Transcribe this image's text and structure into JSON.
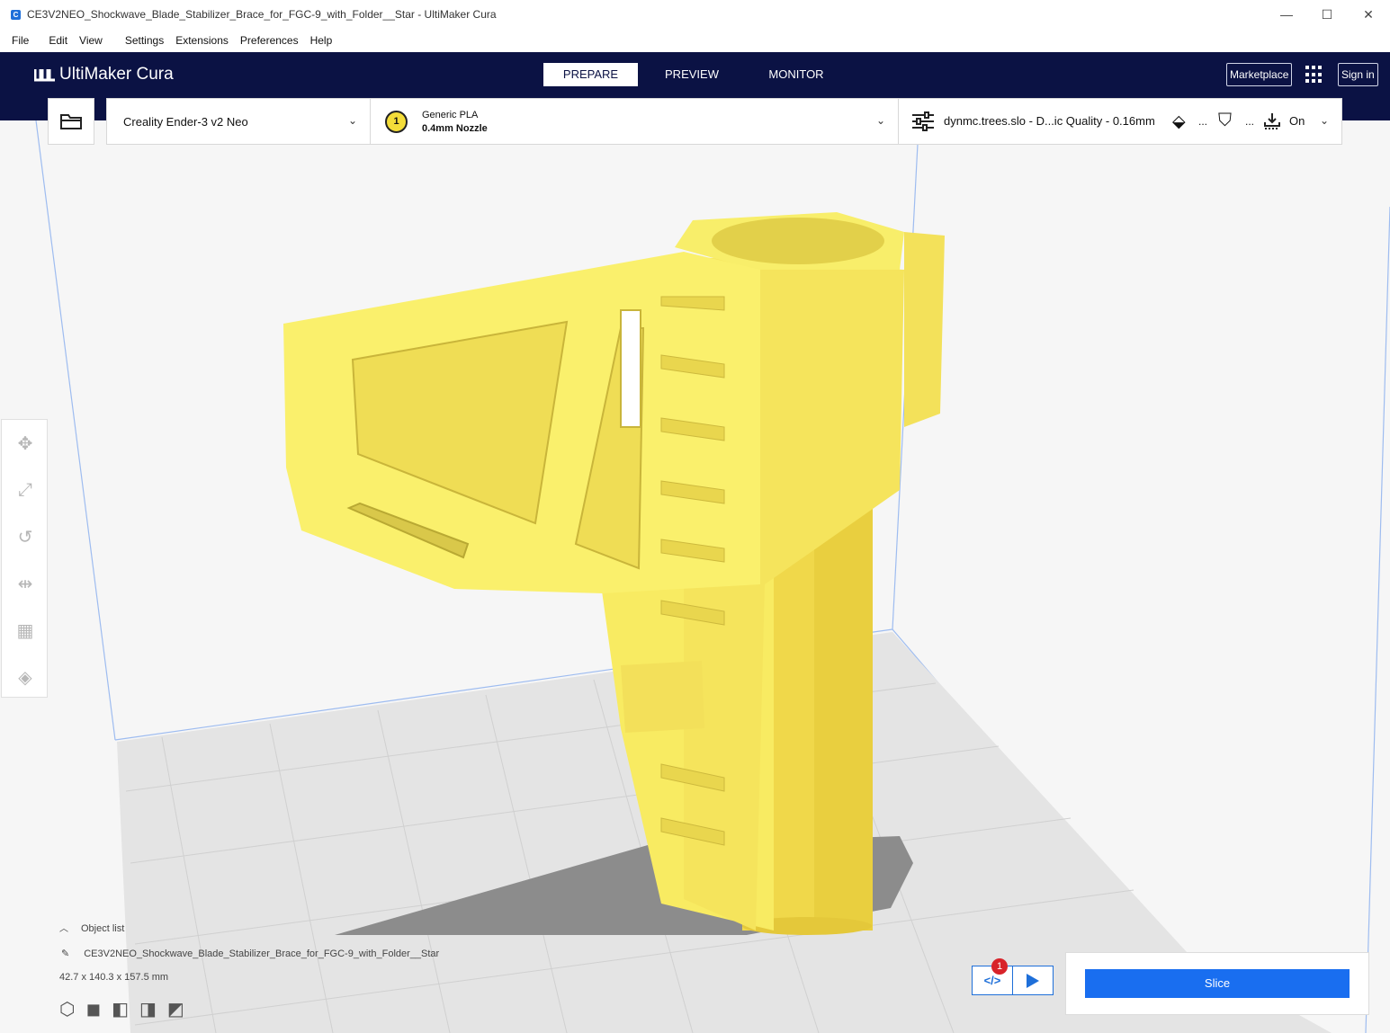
{
  "window": {
    "title": "CE3V2NEO_Shockwave_Blade_Stabilizer_Brace_for_FGC-9_with_Folder__Star - UltiMaker Cura",
    "app_icon_letter": "C",
    "minimize": "—",
    "maximize": "☐",
    "close": "✕"
  },
  "menu": {
    "items": [
      "File",
      "Edit",
      "View",
      "Settings",
      "Extensions",
      "Preferences",
      "Help"
    ]
  },
  "header": {
    "logo_mark": "\\/\\/",
    "logo_text": "UltiMaker Cura",
    "stages": [
      {
        "label": "PREPARE",
        "active": true
      },
      {
        "label": "PREVIEW",
        "active": false
      },
      {
        "label": "MONITOR",
        "active": false
      }
    ],
    "marketplace": "Marketplace",
    "sign_in": "Sign in"
  },
  "toolbar": {
    "printer": "Creality Ender-3 v2 Neo",
    "extruder_number": "1",
    "material": "Generic PLA",
    "nozzle": "0.4mm Nozzle",
    "profile": "dynmc.trees.slo - D...ic Quality - 0.16mm",
    "support_ellipsis": "...",
    "adhesion_ellipsis": "...",
    "adhesion_state": "On"
  },
  "object": {
    "list_label": "Object list",
    "name": "CE3V2NEO_Shockwave_Blade_Stabilizer_Brace_for_FGC-9_with_Folder__Star",
    "dimensions": "42.7 x 140.3 x 157.5 mm"
  },
  "slice": {
    "label": "Slice",
    "notification_count": "1"
  },
  "colors": {
    "header_bg": "#0b1244",
    "model_yellow": "#f8eb62",
    "slice_blue": "#196ef0",
    "badge_red": "#d8232a"
  }
}
